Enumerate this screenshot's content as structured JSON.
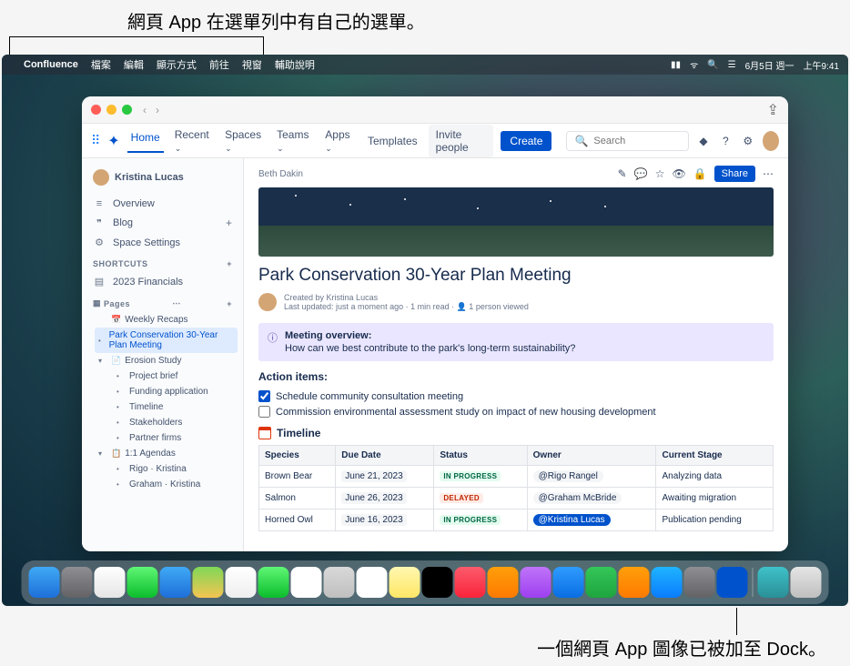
{
  "annotations": {
    "top": "網頁 App 在選單列中有自己的選單。",
    "bottom": "一個網頁 App 圖像已被加至 Dock。"
  },
  "menubar": {
    "app_name": "Confluence",
    "items": [
      "檔案",
      "編輯",
      "顯示方式",
      "前往",
      "視窗",
      "輔助說明"
    ],
    "date": "6月5日 週一",
    "time": "上午9:41"
  },
  "topnav": {
    "home": "Home",
    "recent": "Recent",
    "spaces": "Spaces",
    "teams": "Teams",
    "apps": "Apps",
    "templates": "Templates",
    "invite": "Invite people",
    "create": "Create",
    "search_placeholder": "Search"
  },
  "sidebar": {
    "user": "Kristina Lucas",
    "overview": "Overview",
    "blog": "Blog",
    "space_settings": "Space Settings",
    "shortcuts_h": "SHORTCUTS",
    "shortcut1": "2023 Financials",
    "pages_h": "Pages",
    "weekly": "Weekly Recaps",
    "park": "Park Conservation 30-Year Plan Meeting",
    "erosion": "Erosion Study",
    "erosion_children": [
      "Project brief",
      "Funding application",
      "Timeline",
      "Stakeholders",
      "Partner firms"
    ],
    "agendas": "1:1 Agendas",
    "agendas_children": [
      "Rigo · Kristina",
      "Graham · Kristina"
    ]
  },
  "page": {
    "breadcrumb": "Beth Dakin",
    "share": "Share",
    "title": "Park Conservation 30-Year Plan Meeting",
    "created_by_label": "Created by",
    "created_by": "Kristina Lucas",
    "meta": "Last updated: just a moment ago  ·  1 min read  ·  👤 1 person viewed",
    "overview_h": "Meeting overview:",
    "overview_body": "How can we best contribute to the park's long-term sustainability?",
    "action_h": "Action items:",
    "action1": "Schedule community consultation meeting",
    "action2": "Commission environmental assessment study on impact of new housing development",
    "timeline_h": "Timeline",
    "table": {
      "headers": [
        "Species",
        "Due Date",
        "Status",
        "Owner",
        "Current Stage"
      ],
      "rows": [
        {
          "species": "Brown Bear",
          "due": "June 21, 2023",
          "status": "IN PROGRESS",
          "status_cls": "st-progress",
          "owner": "@Rigo Rangel",
          "owner_cls": "",
          "stage": "Analyzing data"
        },
        {
          "species": "Salmon",
          "due": "June 26, 2023",
          "status": "DELAYED",
          "status_cls": "st-delayed",
          "owner": "@Graham McBride",
          "owner_cls": "",
          "stage": "Awaiting migration"
        },
        {
          "species": "Horned Owl",
          "due": "June 16, 2023",
          "status": "IN PROGRESS",
          "status_cls": "st-progress",
          "owner": "@Kristina Lucas",
          "owner_cls": "me",
          "stage": "Publication pending"
        }
      ]
    }
  },
  "dock": {
    "items": [
      {
        "name": "finder",
        "bg": "linear-gradient(#3fa9f5,#1e6fd9)"
      },
      {
        "name": "launchpad",
        "bg": "linear-gradient(#8e8e93,#636366)"
      },
      {
        "name": "safari",
        "bg": "linear-gradient(#fff,#e5e5e5)"
      },
      {
        "name": "messages",
        "bg": "linear-gradient(#5ff675,#0bbd2c)"
      },
      {
        "name": "mail",
        "bg": "linear-gradient(#3fa9f5,#1e6fd9)"
      },
      {
        "name": "maps",
        "bg": "linear-gradient(#7fd858,#f5c451)"
      },
      {
        "name": "photos",
        "bg": "linear-gradient(#fff,#eee)"
      },
      {
        "name": "facetime",
        "bg": "linear-gradient(#5ff675,#0bbd2c)"
      },
      {
        "name": "calendar",
        "bg": "#fff"
      },
      {
        "name": "contacts",
        "bg": "linear-gradient(#d9d9d9,#bfbfbf)"
      },
      {
        "name": "reminders",
        "bg": "#fff"
      },
      {
        "name": "notes",
        "bg": "linear-gradient(#fff7b0,#ffe766)"
      },
      {
        "name": "tv",
        "bg": "#000"
      },
      {
        "name": "music",
        "bg": "linear-gradient(#fb5b6b,#fa233b)"
      },
      {
        "name": "books",
        "bg": "linear-gradient(#ff9f0a,#ff7a00)"
      },
      {
        "name": "podcasts",
        "bg": "linear-gradient(#c074f9,#9d3ff0)"
      },
      {
        "name": "keynote",
        "bg": "linear-gradient(#2f9bff,#0a6ee3)"
      },
      {
        "name": "numbers",
        "bg": "linear-gradient(#34c759,#1ea53e)"
      },
      {
        "name": "pages",
        "bg": "linear-gradient(#ff9f0a,#ff7a00)"
      },
      {
        "name": "appstore",
        "bg": "linear-gradient(#1fb4ff,#0a7cff)"
      },
      {
        "name": "settings",
        "bg": "linear-gradient(#8e8e93,#636366)"
      },
      {
        "name": "confluence-webapp",
        "bg": "#0052cc"
      }
    ],
    "right": [
      {
        "name": "downloads",
        "bg": "linear-gradient(#3fc1c9,#2a8f96)"
      },
      {
        "name": "trash",
        "bg": "linear-gradient(#e5e5e5,#bfbfbf)"
      }
    ]
  }
}
